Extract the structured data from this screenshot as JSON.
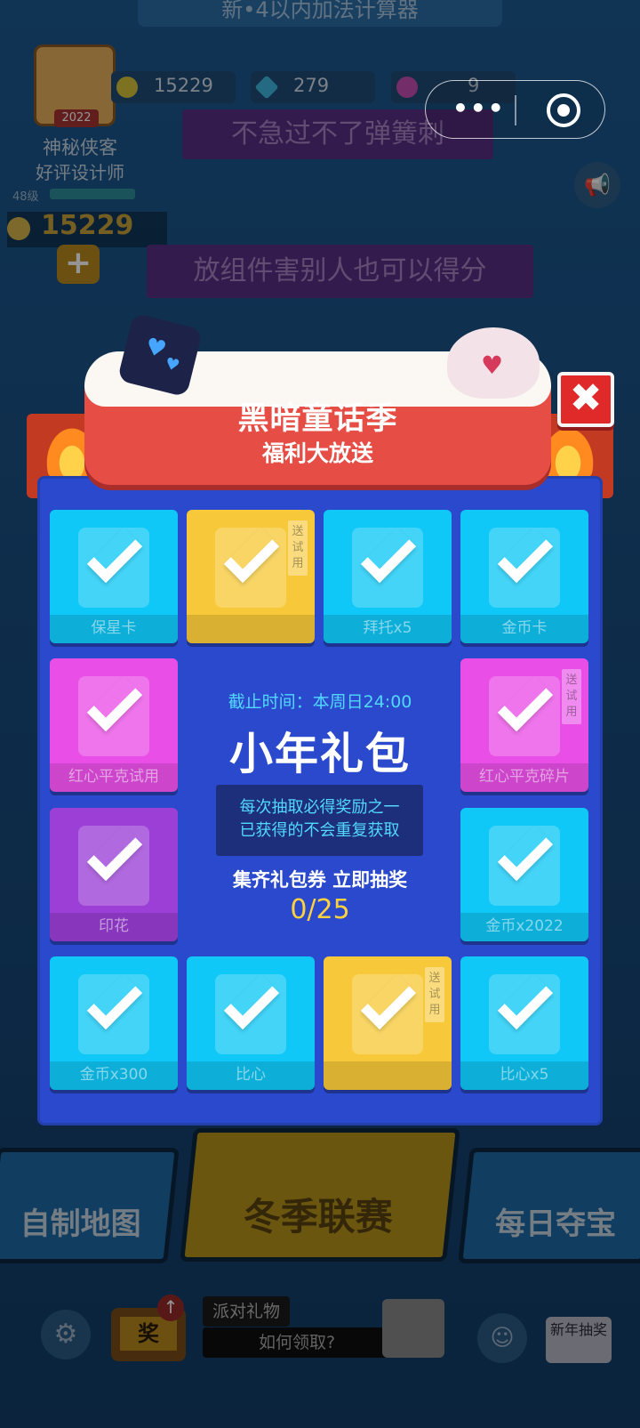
{
  "background": {
    "top_banner": "新•4以内加法计算器",
    "profile": {
      "name": "神秘侠客",
      "title": "好评设计师",
      "level": "48级",
      "avatar_badge": "2022",
      "coins": "15229"
    },
    "stats": {
      "coins": "15229",
      "gems": "279",
      "tickets": "9"
    },
    "bubbles": [
      "不急过不了弹簧刺",
      "放组件害别人也可以得分"
    ],
    "bottom_buttons": {
      "custom_map": "自制地图",
      "winter_league": "冬季联赛",
      "daily_treasure": "每日夺宝"
    },
    "reward_tv": "奖",
    "party_gift": "派对礼物",
    "how_to_claim": "如何领取?",
    "new_year_draw": "新年抽奖"
  },
  "mini_program_menu": {
    "more_icon": "more-dots-icon",
    "close_icon": "target-close-icon"
  },
  "modal": {
    "title": "黑暗童话季",
    "subtitle": "福利大放送",
    "close_label": "✖",
    "deadline": "截止时间：本周日24:00",
    "pack_name": "小年礼包",
    "note_lines": [
      "每次抽取必得奖励之一",
      "已获得的不会重复获取"
    ],
    "collect_text": "集齐礼包券 立即抽奖",
    "progress": "0/25",
    "trial_tag": "送试用",
    "rewards": [
      {
        "label": "保星卡",
        "color": "cyan",
        "trial": false
      },
      {
        "label": "",
        "color": "yellow",
        "trial": true
      },
      {
        "label": "拜托x5",
        "color": "cyan",
        "trial": false
      },
      {
        "label": "金币卡",
        "color": "cyan",
        "trial": false
      },
      {
        "label": "红心平克试用",
        "color": "pink",
        "trial": false
      },
      {
        "label": "红心平克碎片",
        "color": "pink",
        "trial": true
      },
      {
        "label": "印花",
        "color": "purple",
        "trial": false
      },
      {
        "label": "金币x2022",
        "color": "cyan",
        "trial": false
      },
      {
        "label": "金币x300",
        "color": "cyan",
        "trial": false
      },
      {
        "label": "比心",
        "color": "cyan",
        "trial": false
      },
      {
        "label": "",
        "color": "yellow",
        "trial": true
      },
      {
        "label": "比心x5",
        "color": "cyan",
        "trial": false
      }
    ]
  },
  "colors": {
    "panel": "#2a49cc",
    "ribbon": "#e64d44",
    "accent_cyan": "#52d8ff",
    "progress_yellow": "#ffd23d",
    "close_red": "#e02a2a"
  }
}
